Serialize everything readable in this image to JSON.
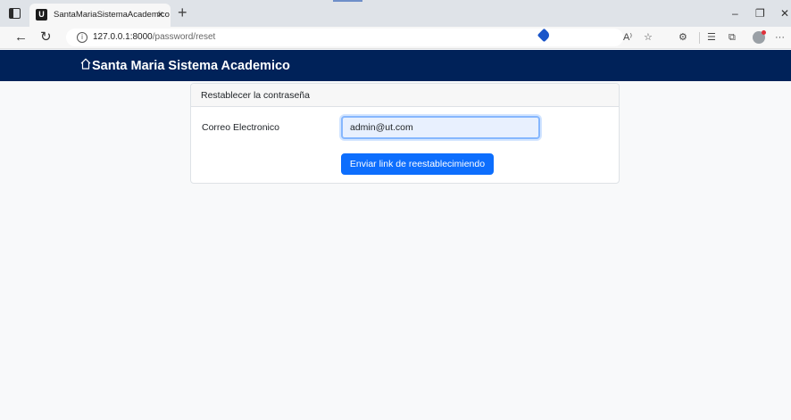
{
  "browser": {
    "tab_title": "SantaMariaSistemaAcademico",
    "tab_favicon_letter": "U",
    "tab_close": "×",
    "new_tab": "+",
    "url_host": "127.0.0.1:8000",
    "url_path": "/password/reset",
    "window_controls": {
      "minimize": "–",
      "restore": "❐",
      "close": "✕"
    },
    "nav": {
      "back": "←",
      "refresh": "↻"
    },
    "tools": {
      "read_aloud": "A⁾",
      "favorite": "☆",
      "extensions": "⚙",
      "favorites_list": "☰",
      "collections": "⧉",
      "more": "···"
    },
    "accent_color": "#1a55c9"
  },
  "navbar": {
    "brand": "Santa Maria Sistema Academico",
    "background": "#002259",
    "icon": "home-icon"
  },
  "card": {
    "header": "Restablecer la contraseña",
    "email_label": "Correo Electronico",
    "email_value": "admin@ut.com",
    "submit_label": "Enviar link de reestablecimiendo",
    "button_color": "#0d6efd"
  }
}
